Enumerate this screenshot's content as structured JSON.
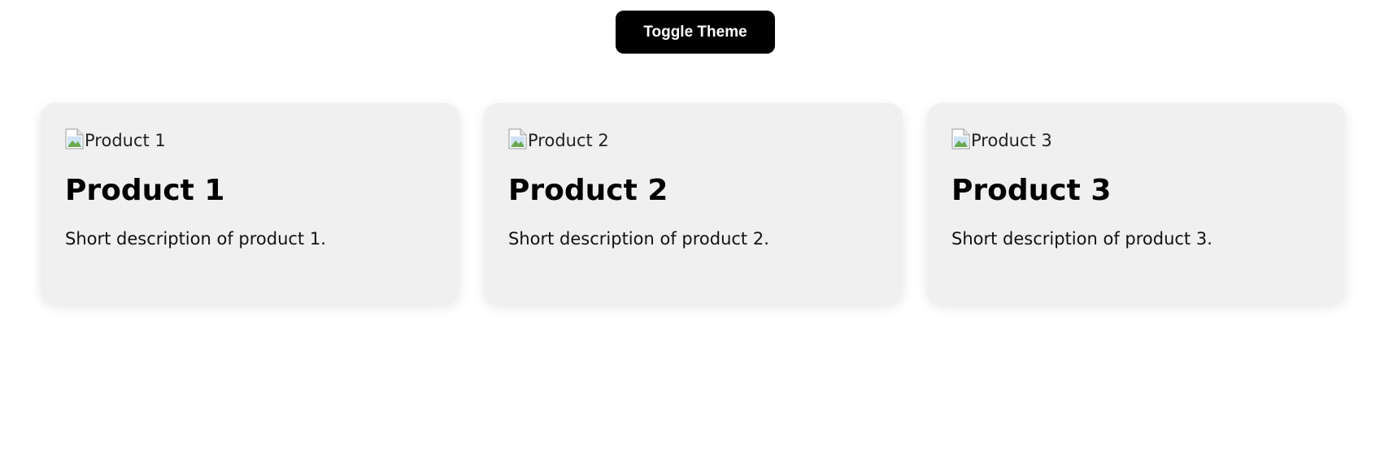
{
  "toolbar": {
    "toggle_label": "Toggle Theme"
  },
  "products": [
    {
      "image_alt": "Product 1",
      "title": "Product 1",
      "description": "Short description of product 1."
    },
    {
      "image_alt": "Product 2",
      "title": "Product 2",
      "description": "Short description of product 2."
    },
    {
      "image_alt": "Product 3",
      "title": "Product 3",
      "description": "Short description of product 3."
    }
  ],
  "colors": {
    "button_bg": "#000000",
    "card_bg": "#f0f0f0",
    "page_bg": "#ffffff"
  }
}
